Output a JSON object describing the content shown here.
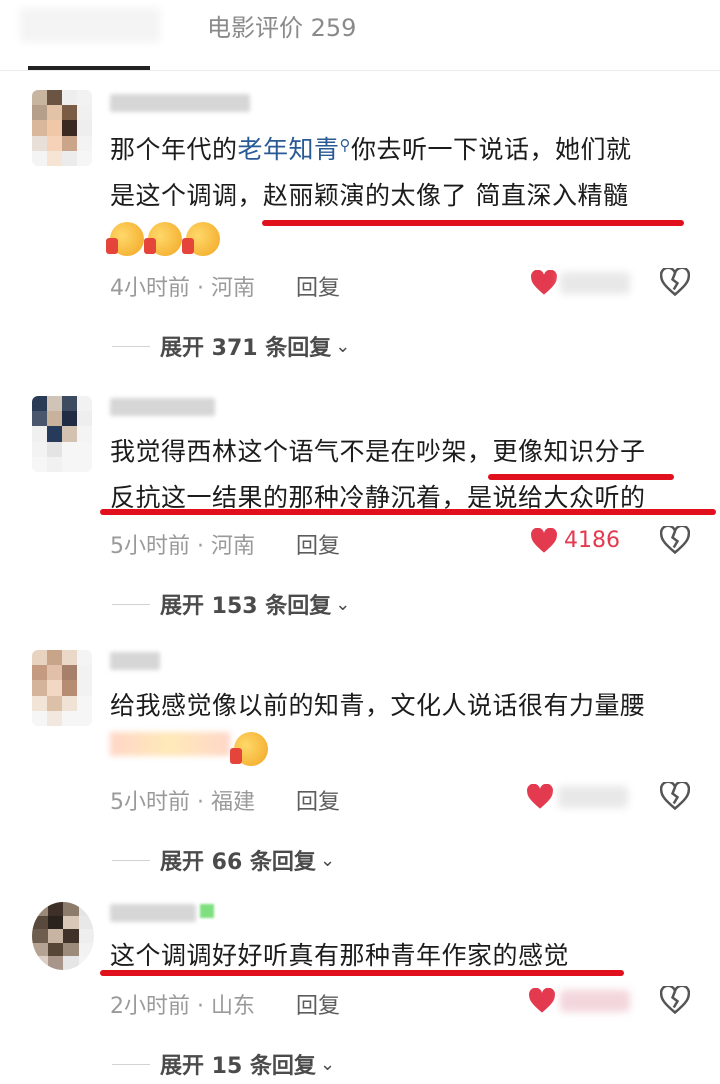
{
  "header": {
    "tab_label": "电影评价 259"
  },
  "comments": [
    {
      "text_line1_a": "那个年代的",
      "text_line1_link": "老年知青",
      "text_line1_b": "你去听一下说话，她们就",
      "text_line2": "是这个调调，赵丽颖演的太像了 简直深入精髓",
      "meta": "4小时前 · 河南",
      "reply": "回复",
      "like_count": "",
      "expand": "展开 371 条回复"
    },
    {
      "text_line1": "我觉得西林这个语气不是在吵架，更像知识分子",
      "text_line2": "反抗这一结果的那种冷静沉着，是说给大众听的",
      "meta": "5小时前 · 河南",
      "reply": "回复",
      "like_count": "4186",
      "expand": "展开 153 条回复"
    },
    {
      "text_line1": "给我感觉像以前的知青，文化人说话很有力量腰",
      "meta": "5小时前 · 福建",
      "reply": "回复",
      "like_count": "",
      "expand": "展开 66 条回复"
    },
    {
      "text_line1": "这个调调好好听真有那种青年作家的感觉",
      "meta": "2小时前 · 山东",
      "reply": "回复",
      "like_count": "",
      "expand": "展开 15 条回复"
    }
  ],
  "icons": {
    "search": "search-icon",
    "like": "heart-icon",
    "dislike": "broken-heart-icon",
    "expand": "chevron-down-icon",
    "emoji": "thumbs-up-emoji-icon"
  },
  "colors": {
    "like": "#e33a4f",
    "link": "#2a5a96",
    "annotation": "#e0101c"
  }
}
